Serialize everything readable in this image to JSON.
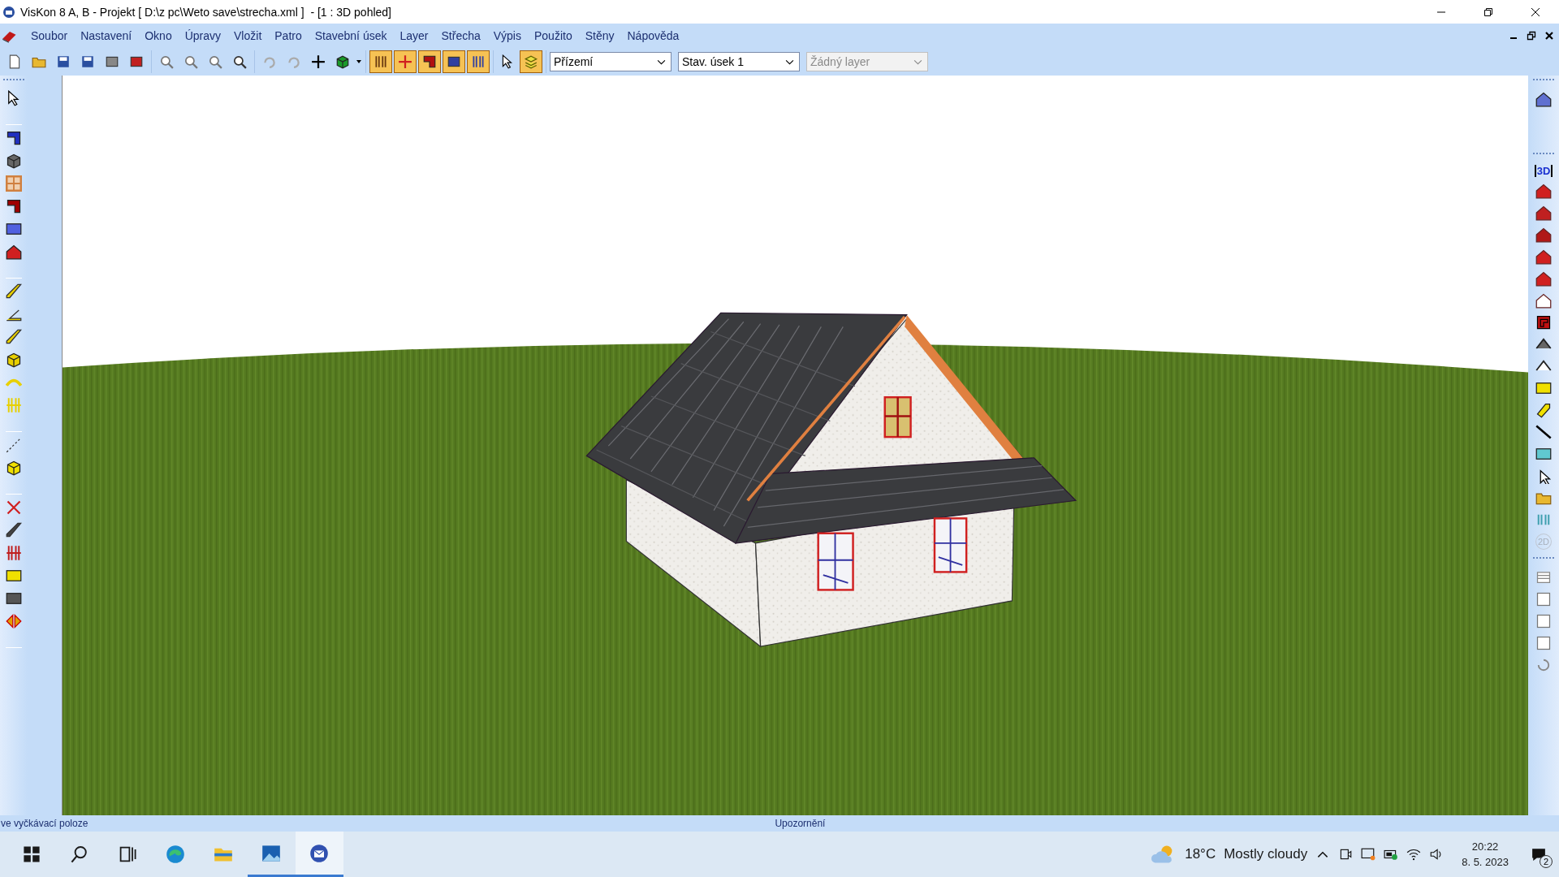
{
  "window": {
    "title": "VisKon 8 A, B - Projekt [ D:\\z pc\\Weto save\\strecha.xml ]  - [1 : 3D pohled]"
  },
  "menu": [
    "Soubor",
    "Nastavení",
    "Okno",
    "Úpravy",
    "Vložit",
    "Patro",
    "Stavební úsek",
    "Layer",
    "Střecha",
    "Výpis",
    "Použito",
    "Stěny",
    "Nápověda"
  ],
  "dropdowns": [
    {
      "value": "Přízemí",
      "disabled": false
    },
    {
      "value": "Stav. úsek 1",
      "disabled": false
    },
    {
      "value": "Žádný layer",
      "disabled": true
    }
  ],
  "right_toolbar": {
    "view_3d": "3D",
    "view_2d": "2D"
  },
  "status_bar": {
    "left": "ve vyčkávací poloze",
    "center": "Upozornění"
  },
  "taskbar": {
    "temperature": "18°C",
    "weather": "Mostly cloudy",
    "time": "20:22",
    "date": "8. 5. 2023",
    "notifications": "2"
  }
}
